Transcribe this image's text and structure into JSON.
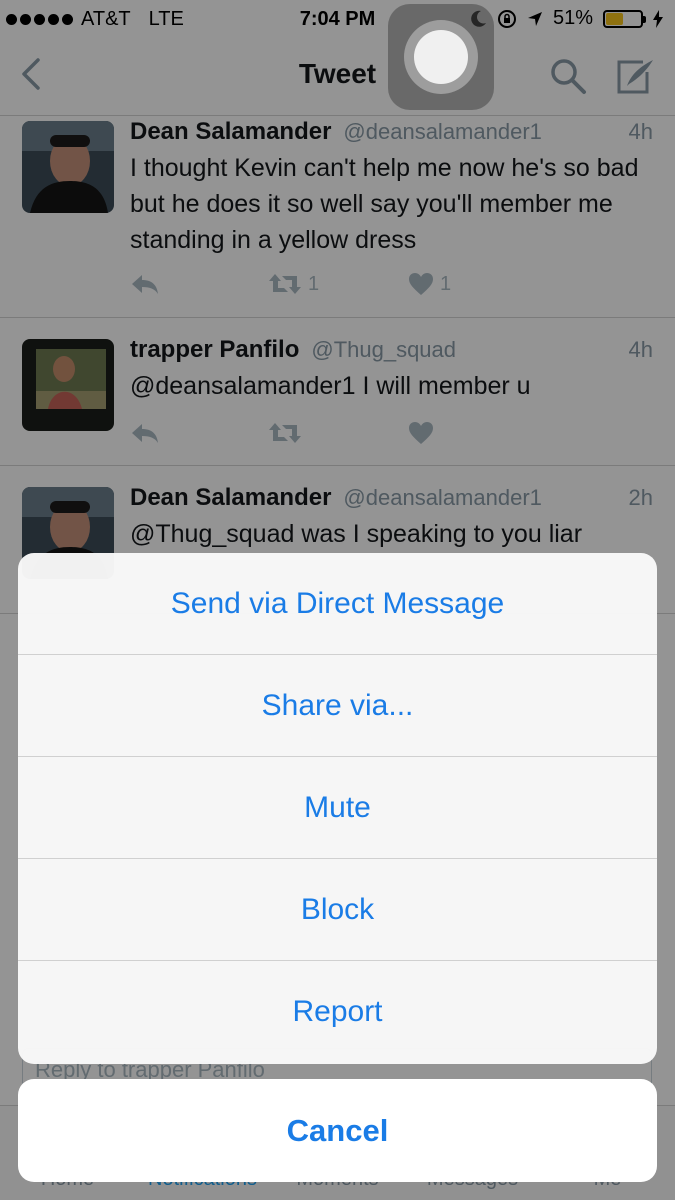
{
  "status_bar": {
    "carrier": "AT&T",
    "network": "LTE",
    "time": "7:04 PM",
    "battery": "51%",
    "battery_level": 0.51,
    "battery_color": "#f5c31d"
  },
  "nav": {
    "title": "Tweet",
    "back_icon": "chevron-left-icon",
    "search_icon": "search-icon",
    "compose_icon": "compose-icon"
  },
  "tweets": [
    {
      "name": "Dean Salamander",
      "handle": "@deansalamander1",
      "time": "4h",
      "text": "I thought Kevin can't help me now he's so bad but he does it so well say you'll member me standing in a yellow dress",
      "retweets": "1",
      "likes": "1"
    },
    {
      "name": "trapper Panfilo",
      "handle": "@Thug_squad",
      "time": "4h",
      "text": "@deansalamander1 I will member u",
      "retweets": "",
      "likes": ""
    },
    {
      "name": "Dean Salamander",
      "handle": "@deansalamander1",
      "time": "2h",
      "text": "@Thug_squad was I speaking to you liar",
      "retweets": "",
      "likes": ""
    }
  ],
  "reply_box": {
    "placeholder": "Reply to trapper Panfilo"
  },
  "tab_bar": {
    "tabs": [
      "Home",
      "Notifications",
      "Moments",
      "Messages",
      "Me"
    ],
    "active": "Notifications"
  },
  "action_sheet": {
    "items": [
      "Send via Direct Message",
      "Share via...",
      "Mute",
      "Block",
      "Report"
    ],
    "cancel": "Cancel",
    "accent": "#1a7ce6"
  }
}
